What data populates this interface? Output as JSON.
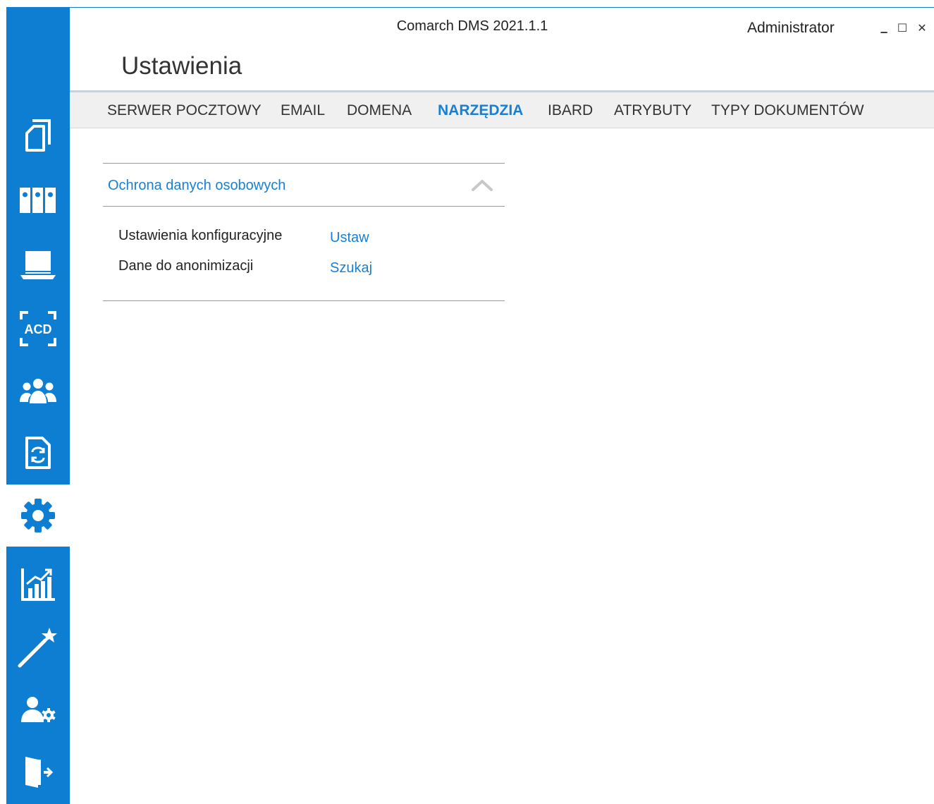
{
  "window": {
    "title": "Comarch DMS 2021.1.1",
    "user": "Administrator",
    "minimize_glyph": "▁",
    "maximize_glyph": "☐",
    "close_glyph": "✕"
  },
  "page": {
    "title": "Ustawienia"
  },
  "colors": {
    "accent": "#0d7ed2",
    "link": "#1a7fd1",
    "tabs_background": "#f0f0f0"
  },
  "sidebar": {
    "items": [
      {
        "icon": "documents-icon",
        "active": false
      },
      {
        "icon": "binders-icon",
        "active": false
      },
      {
        "icon": "laptop-icon",
        "active": false
      },
      {
        "icon": "ocr-acd-icon",
        "active": false
      },
      {
        "icon": "users-group-icon",
        "active": false
      },
      {
        "icon": "document-sync-icon",
        "active": false
      },
      {
        "icon": "gear-icon",
        "active": true
      },
      {
        "icon": "chart-icon",
        "active": false
      },
      {
        "icon": "magic-wand-icon",
        "active": false
      },
      {
        "icon": "user-settings-icon",
        "active": false
      },
      {
        "icon": "exit-door-icon",
        "active": false
      }
    ],
    "ocr_label": "ACD"
  },
  "tabs": [
    {
      "label": "SERWER POCZTOWY",
      "active": false
    },
    {
      "label": "EMAIL",
      "active": false
    },
    {
      "label": "DOMENA",
      "active": false
    },
    {
      "label": "NARZĘDZIA",
      "active": true
    },
    {
      "label": "IBARD",
      "active": false
    },
    {
      "label": "ATRYBUTY",
      "active": false
    },
    {
      "label": "TYPY DOKUMENTÓW",
      "active": false
    }
  ],
  "section": {
    "title": "Ochrona danych osobowych",
    "expanded": true,
    "rows": [
      {
        "label": "Ustawienia konfiguracyjne",
        "action": "Ustaw"
      },
      {
        "label": "Dane do anonimizacji",
        "action": "Szukaj"
      }
    ]
  }
}
